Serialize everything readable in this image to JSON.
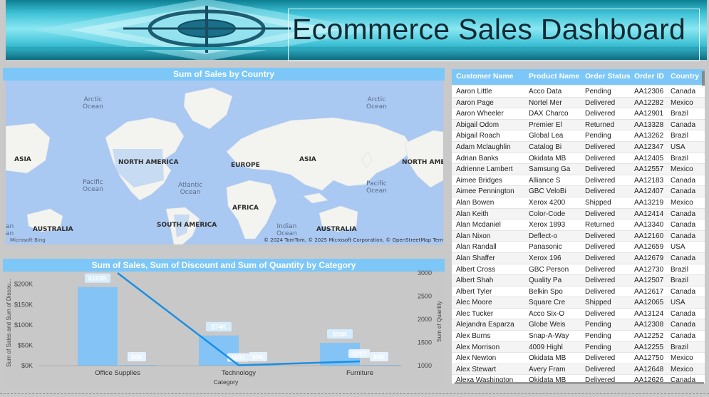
{
  "header": {
    "title": "Ecommerce Sales Dashboard"
  },
  "map": {
    "title": "Sum of Sales by Country",
    "labels": {
      "arctic1": "Arctic\nOcean",
      "arctic2": "Arctic\nOcean",
      "asia_left": "ASIA",
      "north_america": "NORTH AMERICA",
      "europe": "EUROPE",
      "asia": "ASIA",
      "north_america_right": "NORTH AMEI",
      "pacific1": "Pacific\nOcean",
      "atlantic": "Atlantic\nOcean",
      "pacific2": "Pacific\nOcean",
      "africa": "AFRICA",
      "south_america": "SOUTH AMERICA",
      "indian": "Indian\nOcean",
      "australia_left": "AUSTRALIA",
      "australia": "AUSTRALIA",
      "an_partial": "an\nan"
    },
    "attribution": "© 2024 TomTom, © 2025 Microsoft Corporation, © OpenStreetMap  Terms",
    "logo": "Microsoft Bing"
  },
  "chart_data": {
    "type": "bar",
    "title": "Sum of Sales, Sum of Discount and Sum of Quantity by Category",
    "xlabel": "Category",
    "ylabel": "Sum of Sales and Sum of Discou...",
    "y2label": "Sum of Quantity",
    "categories": [
      "Office Supplies",
      "Technology",
      "Furniture"
    ],
    "series": [
      {
        "name": "Sum of Sales",
        "kind": "bar",
        "values": [
          193000,
          74000,
          56000
        ],
        "labels": [
          "$193K",
          "$74K",
          "$56K"
        ],
        "color": "#84c3f5"
      },
      {
        "name": "Sum of Discount",
        "kind": "bar",
        "values": [
          0,
          0,
          0
        ],
        "labels": [
          "$0K",
          "$0K",
          "$0K"
        ],
        "color": "#84c3f5"
      },
      {
        "name": "Sum of Quantity",
        "kind": "line",
        "axis": "right",
        "values": [
          3000,
          1007,
          1093
        ],
        "labels": [
          "",
          "1007",
          "1093"
        ],
        "color": "#1a8fe3"
      }
    ],
    "ylim": [
      0,
      210000
    ],
    "yticks": [
      "$0K",
      "$50K",
      "$100K",
      "$150K",
      "$200K"
    ],
    "ytick_values": [
      0,
      50000,
      100000,
      150000,
      200000
    ],
    "y2lim": [
      1000,
      3000
    ],
    "y2ticks": [
      "1000",
      "1500",
      "2000",
      "2500",
      "3000"
    ],
    "y2tick_values": [
      1000,
      1500,
      2000,
      2500,
      3000
    ]
  },
  "table": {
    "columns": [
      "Customer Name",
      "Product Name",
      "Order Status",
      "Order ID",
      "Country"
    ],
    "rows": [
      [
        "Aaron Little",
        "Acco Data",
        "Pending",
        "AA12306",
        "Canada"
      ],
      [
        "Aaron Page",
        "Nortel Mer",
        "Delivered",
        "AA12282",
        "Mexico"
      ],
      [
        "Aaron Wheeler",
        "DAX Charco",
        "Delivered",
        "AA12901",
        "Brazil"
      ],
      [
        "Abigail Odom",
        "Premier El",
        "Returned",
        "AA13328",
        "Canada"
      ],
      [
        "Abigail Roach",
        "Global Lea",
        "Pending",
        "AA13262",
        "Brazil"
      ],
      [
        "Adam Mclaughlin",
        "Catalog Bi",
        "Delivered",
        "AA12347",
        "USA"
      ],
      [
        "Adrian Banks",
        "Okidata MB",
        "Delivered",
        "AA12405",
        "Brazil"
      ],
      [
        "Adrienne Lambert",
        "Samsung Ga",
        "Delivered",
        "AA12557",
        "Mexico"
      ],
      [
        "Aimee Bridges",
        "Alliance S",
        "Delivered",
        "AA12183",
        "Canada"
      ],
      [
        "Aimee Pennington",
        "GBC VeloBi",
        "Delivered",
        "AA12407",
        "Canada"
      ],
      [
        "Alan Bowen",
        "Xerox 4200",
        "Shipped",
        "AA13219",
        "Mexico"
      ],
      [
        "Alan Keith",
        "Color-Code",
        "Delivered",
        "AA12414",
        "Canada"
      ],
      [
        "Alan Mcdaniel",
        "Xerox 1893",
        "Returned",
        "AA13340",
        "Canada"
      ],
      [
        "Alan Nixon",
        "Deflect-o",
        "Delivered",
        "AA12160",
        "Canada"
      ],
      [
        "Alan Randall",
        "Panasonic",
        "Delivered",
        "AA12659",
        "USA"
      ],
      [
        "Alan Shaffer",
        "Xerox 196",
        "Delivered",
        "AA12679",
        "Canada"
      ],
      [
        "Albert Cross",
        "GBC Person",
        "Delivered",
        "AA12730",
        "Brazil"
      ],
      [
        "Albert Shah",
        "Quality Pa",
        "Delivered",
        "AA12507",
        "Brazil"
      ],
      [
        "Albert Tyler",
        "Belkin Spo",
        "Delivered",
        "AA12617",
        "Canada"
      ],
      [
        "Alec Moore",
        "Square Cre",
        "Shipped",
        "AA12065",
        "USA"
      ],
      [
        "Alec Tucker",
        "Acco Six-O",
        "Delivered",
        "AA13124",
        "Canada"
      ],
      [
        "Alejandra Esparza",
        "Globe Weis",
        "Pending",
        "AA12308",
        "Canada"
      ],
      [
        "Alex Burns",
        "Snap-A-Way",
        "Pending",
        "AA12252",
        "Canada"
      ],
      [
        "Alex Morrison",
        "4009 Highl",
        "Pending",
        "AA12255",
        "Brazil"
      ],
      [
        "Alex Newton",
        "Okidata MB",
        "Delivered",
        "AA12750",
        "Mexico"
      ],
      [
        "Alex Stewart",
        "Avery Fram",
        "Delivered",
        "AA12648",
        "Mexico"
      ],
      [
        "Alexa Washington",
        "Okidata MB",
        "Delivered",
        "AA12626",
        "Canada"
      ]
    ]
  }
}
